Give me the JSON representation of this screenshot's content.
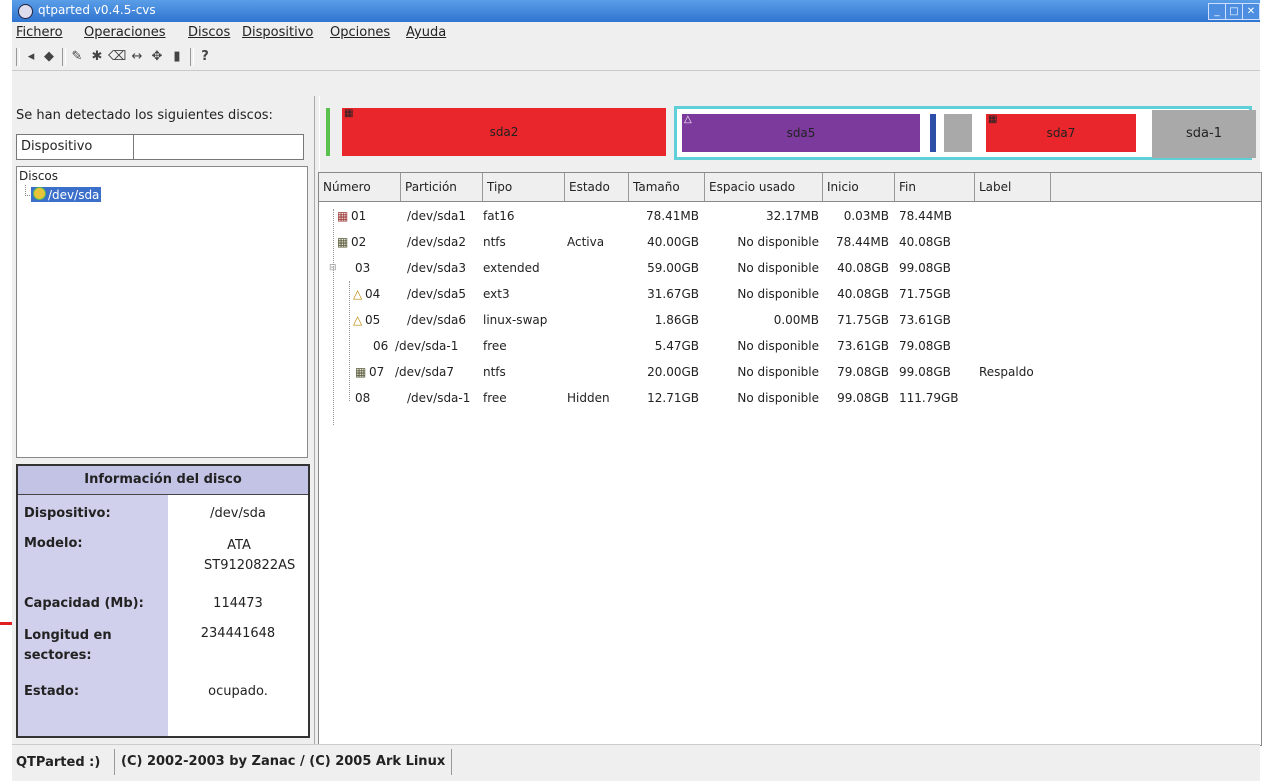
{
  "window": {
    "title": "qtparted v0.4.5-cvs"
  },
  "menu": [
    "Fichero",
    "Operaciones",
    "Discos",
    "Dispositivo",
    "Opciones",
    "Ayuda"
  ],
  "toolbar_icons": [
    "disk-icon",
    "partition-icon",
    "format-icon",
    "properties-icon",
    "delete-icon",
    "resize-icon",
    "move-icon",
    "trash-icon",
    "whats-this-icon"
  ],
  "left": {
    "detected_label": "Se han detectado los siguientes discos:",
    "device_column": "Dispositivo",
    "tree_header": "Discos",
    "tree_item": "/dev/sda"
  },
  "info": {
    "title": "Información del disco",
    "rows": [
      {
        "label": "Dispositivo:",
        "value": "/dev/sda"
      },
      {
        "label": "Modelo:",
        "value": "ATA ST9120822AS"
      },
      {
        "label": "Capacidad (Mb):",
        "value": "114473"
      },
      {
        "label": "Longitud en sectores:",
        "value": "234441648"
      },
      {
        "label": "Estado:",
        "value": "ocupado."
      }
    ]
  },
  "partition_map": {
    "segments": [
      "sda2",
      "sda5",
      "sda7",
      "sda-1"
    ],
    "colors": {
      "fat16": "#5bc24f",
      "ntfs": "#e8262b",
      "ext3": "#7c3a9c",
      "swap": "#2e4fa8",
      "free": "#a9a9a9",
      "extended": "#5fd0d8"
    }
  },
  "table": {
    "headers": [
      "Número",
      "Partición",
      "Tipo",
      "Estado",
      "Tamaño",
      "Espacio usado",
      "Inicio",
      "Fin",
      "Label"
    ],
    "rows": [
      {
        "num": "01",
        "part": "/dev/sda1",
        "type": "fat16",
        "state": "",
        "size": "78.41MB",
        "used": "32.17MB",
        "start": "0.03MB",
        "end": "78.44MB",
        "label": "",
        "icon": "windows-icon"
      },
      {
        "num": "02",
        "part": "/dev/sda2",
        "type": "ntfs",
        "state": "Activa",
        "size": "40.00GB",
        "used": "No disponible",
        "start": "78.44MB",
        "end": "40.08GB",
        "label": "",
        "icon": "windows-icon"
      },
      {
        "num": "03",
        "part": "/dev/sda3",
        "type": "extended",
        "state": "",
        "size": "59.00GB",
        "used": "No disponible",
        "start": "40.08GB",
        "end": "99.08GB",
        "label": "",
        "icon": ""
      },
      {
        "num": "04",
        "part": "/dev/sda5",
        "type": "ext3",
        "state": "",
        "size": "31.67GB",
        "used": "No disponible",
        "start": "40.08GB",
        "end": "71.75GB",
        "label": "",
        "icon": "linux-icon"
      },
      {
        "num": "05",
        "part": "/dev/sda6",
        "type": "linux-swap",
        "state": "",
        "size": "1.86GB",
        "used": "0.00MB",
        "start": "71.75GB",
        "end": "73.61GB",
        "label": "",
        "icon": "linux-icon"
      },
      {
        "num": "06",
        "part": "/dev/sda-1",
        "type": "free",
        "state": "",
        "size": "5.47GB",
        "used": "No disponible",
        "start": "73.61GB",
        "end": "79.08GB",
        "label": "",
        "icon": ""
      },
      {
        "num": "07",
        "part": "/dev/sda7",
        "type": "ntfs",
        "state": "",
        "size": "20.00GB",
        "used": "No disponible",
        "start": "79.08GB",
        "end": "99.08GB",
        "label": "Respaldo",
        "icon": "windows-icon"
      },
      {
        "num": "08",
        "part": "/dev/sda-1",
        "type": "free",
        "state": "Hidden",
        "size": "12.71GB",
        "used": "No disponible",
        "start": "99.08GB",
        "end": "111.79GB",
        "label": "",
        "icon": ""
      }
    ]
  },
  "status": {
    "app": "QTParted :)",
    "copyright": "(C) 2002-2003 by Zanac / (C) 2005 Ark Linux"
  }
}
